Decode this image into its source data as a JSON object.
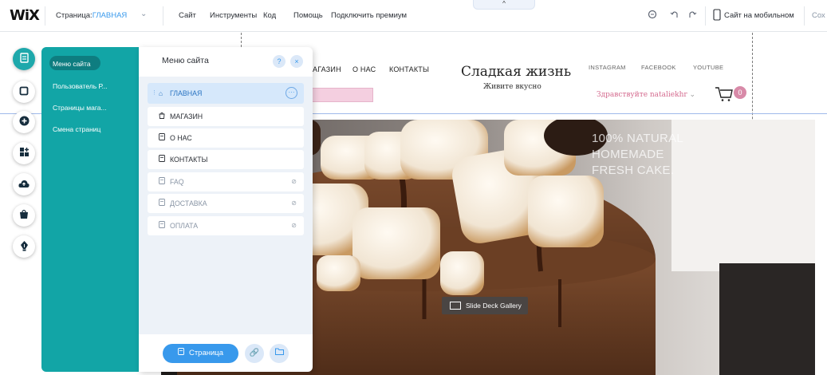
{
  "topbar": {
    "logo": "WiX",
    "page_label": "Страница:",
    "page_value": "ГЛАВНАЯ",
    "menu": [
      "Сайт",
      "Инструменты",
      "Код",
      "Помощь",
      "Подключить премиум"
    ],
    "collapse_glyph": "^",
    "mobile_label": "Сайт на мобильном",
    "save_label": "Сох",
    "icons": [
      "zoom-icon",
      "undo-icon",
      "redo-icon",
      "mobile-icon"
    ]
  },
  "site": {
    "nav": [
      "АГАЗИН",
      "О НАС",
      "КОНТАКТЫ"
    ],
    "title": "Сладкая жизнь",
    "subtitle": "Живите вкусно",
    "social": [
      "INSTAGRAM",
      "FACEBOOK",
      "YOUTUBE"
    ],
    "greeting": "Здравствуйте nataliekhr",
    "cart_count": "0",
    "hero_text": [
      "100% NATURAL",
      "HOMEMADE",
      "FRESH CAKE."
    ],
    "gallery_label": "Slide Deck Gallery"
  },
  "rail": {
    "icons": [
      "pages-icon",
      "background-icon",
      "add-icon",
      "app-market-icon",
      "upload-icon",
      "store-icon",
      "blog-pen-icon"
    ]
  },
  "site_menu": {
    "teal_items": [
      "Меню сайта",
      "Пользователь Р...",
      "Страницы мага...",
      "Смена страниц"
    ],
    "title": "Меню сайта",
    "help_glyph": "?",
    "close_glyph": "×",
    "pages": [
      {
        "label": "ГЛАВНАЯ",
        "icon": "home-icon",
        "hidden": false
      },
      {
        "label": "МАГАЗИН",
        "icon": "shop-icon",
        "hidden": false
      },
      {
        "label": "О НАС",
        "icon": "page-icon",
        "hidden": false
      },
      {
        "label": "КОНТАКТЫ",
        "icon": "page-icon",
        "hidden": false
      },
      {
        "label": "FAQ",
        "icon": "page-icon",
        "hidden": true
      },
      {
        "label": "ДОСТАВКА",
        "icon": "page-icon",
        "hidden": true
      },
      {
        "label": "ОПЛАТА",
        "icon": "page-icon",
        "hidden": true
      }
    ],
    "add_page_label": "Страница"
  },
  "colors": {
    "teal": "#12a5a6",
    "blue": "#3899ec",
    "pink": "#d88aa8"
  }
}
